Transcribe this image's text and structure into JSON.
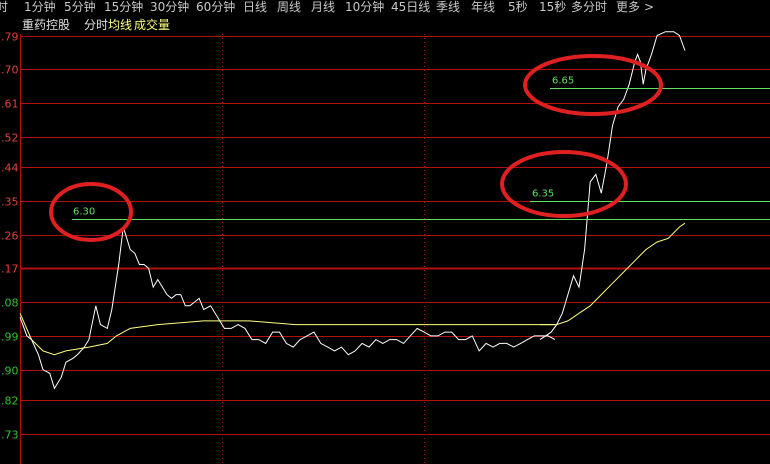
{
  "tabs": [
    {
      "label": "时",
      "id": "fenshi"
    },
    {
      "label": "1分钟",
      "id": "1min"
    },
    {
      "label": "5分钟",
      "id": "5min"
    },
    {
      "label": "15分钟",
      "id": "15min"
    },
    {
      "label": "30分钟",
      "id": "30min"
    },
    {
      "label": "60分钟",
      "id": "60min"
    },
    {
      "label": "日线",
      "id": "day"
    },
    {
      "label": "周线",
      "id": "week"
    },
    {
      "label": "月线",
      "id": "month"
    },
    {
      "label": "10分钟",
      "id": "10min"
    },
    {
      "label": "45日线",
      "id": "45day"
    },
    {
      "label": "季线",
      "id": "quarter"
    },
    {
      "label": "年线",
      "id": "year"
    },
    {
      "label": "5秒",
      "id": "5sec"
    },
    {
      "label": "15秒",
      "id": "15sec"
    },
    {
      "label": "多分时",
      "id": "multi"
    },
    {
      "label": "更多",
      "id": "more"
    }
  ],
  "more_arrow": ">",
  "legend": {
    "stock": "重药控股",
    "price_label": "分时",
    "avg_label": "均线",
    "volume_label": "成交量"
  },
  "colors": {
    "price": "#ffffff",
    "average": "#ffff80",
    "grid_red": "#b01010",
    "axis_red": "#e04040",
    "axis_green": "#30c030",
    "level_line": "#60e060",
    "circle": "#e02020",
    "tab_text": "#c8c8c8"
  },
  "chart_data": {
    "type": "line",
    "title": "",
    "xlabel": "",
    "ylabel": "",
    "ylim": [
      5.69,
      6.81
    ],
    "y_ticks": [
      {
        "value": 6.79,
        "label": ".79",
        "side": "up"
      },
      {
        "value": 6.7,
        "label": ".70",
        "side": "up"
      },
      {
        "value": 6.61,
        "label": ".61",
        "side": "up"
      },
      {
        "value": 6.52,
        "label": ".52",
        "side": "up"
      },
      {
        "value": 6.44,
        "label": ".44",
        "side": "up"
      },
      {
        "value": 6.35,
        "label": ".35",
        "side": "up"
      },
      {
        "value": 6.26,
        "label": ".26",
        "side": "up"
      },
      {
        "value": 6.17,
        "label": ".17",
        "side": "up"
      },
      {
        "value": 6.08,
        "label": ".08",
        "side": "down"
      },
      {
        "value": 5.99,
        "label": ".99",
        "side": "down"
      },
      {
        "value": 5.9,
        "label": ".90",
        "side": "down"
      },
      {
        "value": 5.82,
        "label": ".82",
        "side": "down"
      },
      {
        "value": 5.73,
        "label": ".73",
        "side": "down"
      }
    ],
    "base_value": 6.17,
    "x_points": 234,
    "series": [
      {
        "key": "price",
        "points": [
          [
            0,
            6.04
          ],
          [
            3,
            5.99
          ],
          [
            5,
            5.98
          ],
          [
            8,
            5.94
          ],
          [
            10,
            5.9
          ],
          [
            13,
            5.89
          ],
          [
            15,
            5.85
          ],
          [
            18,
            5.88
          ],
          [
            20,
            5.92
          ],
          [
            23,
            5.93
          ],
          [
            25,
            5.94
          ],
          [
            28,
            5.96
          ],
          [
            30,
            5.98
          ],
          [
            33,
            6.07
          ],
          [
            35,
            6.02
          ],
          [
            38,
            6.01
          ],
          [
            40,
            6.06
          ],
          [
            43,
            6.18
          ],
          [
            45,
            6.28
          ],
          [
            48,
            6.22
          ],
          [
            50,
            6.21
          ],
          [
            52,
            6.18
          ],
          [
            54,
            6.18
          ],
          [
            56,
            6.17
          ],
          [
            58,
            6.12
          ],
          [
            60,
            6.14
          ],
          [
            62,
            6.12
          ],
          [
            64,
            6.1
          ],
          [
            66,
            6.09
          ],
          [
            68,
            6.1
          ],
          [
            70,
            6.1
          ],
          [
            72,
            6.07
          ],
          [
            74,
            6.07
          ],
          [
            76,
            6.08
          ],
          [
            78,
            6.09
          ],
          [
            80,
            6.06
          ],
          [
            83,
            6.07
          ],
          [
            86,
            6.04
          ],
          [
            89,
            6.01
          ],
          [
            92,
            6.01
          ],
          [
            95,
            6.02
          ],
          [
            98,
            6.01
          ],
          [
            101,
            5.98
          ],
          [
            104,
            5.98
          ],
          [
            107,
            5.97
          ],
          [
            110,
            6.0
          ],
          [
            113,
            6.0
          ],
          [
            116,
            5.97
          ],
          [
            119,
            5.96
          ],
          [
            122,
            5.98
          ],
          [
            125,
            5.99
          ],
          [
            128,
            6.0
          ],
          [
            131,
            5.97
          ],
          [
            134,
            5.96
          ],
          [
            137,
            5.95
          ],
          [
            140,
            5.96
          ],
          [
            143,
            5.94
          ],
          [
            146,
            5.95
          ],
          [
            149,
            5.97
          ],
          [
            152,
            5.96
          ],
          [
            155,
            5.98
          ],
          [
            158,
            5.97
          ],
          [
            161,
            5.98
          ],
          [
            164,
            5.98
          ],
          [
            167,
            5.97
          ],
          [
            170,
            5.99
          ],
          [
            173,
            6.01
          ],
          [
            176,
            6.0
          ],
          [
            179,
            5.99
          ],
          [
            182,
            5.99
          ],
          [
            185,
            6.0
          ],
          [
            188,
            6.0
          ],
          [
            191,
            5.98
          ],
          [
            194,
            5.98
          ],
          [
            197,
            5.99
          ],
          [
            200,
            5.95
          ],
          [
            203,
            5.97
          ],
          [
            206,
            5.96
          ],
          [
            209,
            5.97
          ],
          [
            212,
            5.97
          ],
          [
            215,
            5.96
          ],
          [
            218,
            5.97
          ],
          [
            221,
            5.98
          ],
          [
            224,
            5.99
          ],
          [
            227,
            5.99
          ],
          [
            230,
            5.99
          ],
          [
            233,
            5.98
          ]
        ]
      },
      {
        "key": "price_pm",
        "points": [
          [
            0,
            5.98
          ],
          [
            2,
            5.99
          ],
          [
            4,
            6.0
          ],
          [
            6,
            6.02
          ],
          [
            8,
            6.05
          ],
          [
            10,
            6.1
          ],
          [
            12,
            6.15
          ],
          [
            14,
            6.12
          ],
          [
            16,
            6.22
          ],
          [
            18,
            6.4
          ],
          [
            20,
            6.42
          ],
          [
            22,
            6.37
          ],
          [
            24,
            6.45
          ],
          [
            26,
            6.55
          ],
          [
            28,
            6.6
          ],
          [
            30,
            6.62
          ],
          [
            32,
            6.66
          ],
          [
            34,
            6.72
          ],
          [
            35,
            6.74
          ],
          [
            36,
            6.72
          ],
          [
            37,
            6.66
          ],
          [
            38,
            6.7
          ],
          [
            39,
            6.72
          ],
          [
            40,
            6.74
          ],
          [
            42,
            6.79
          ],
          [
            45,
            6.8
          ],
          [
            48,
            6.8
          ],
          [
            50,
            6.79
          ],
          [
            52,
            6.75
          ]
        ]
      },
      {
        "key": "average",
        "points": [
          [
            0,
            6.05
          ],
          [
            5,
            5.98
          ],
          [
            10,
            5.95
          ],
          [
            15,
            5.94
          ],
          [
            20,
            5.95
          ],
          [
            30,
            5.96
          ],
          [
            38,
            5.97
          ],
          [
            42,
            5.99
          ],
          [
            48,
            6.01
          ],
          [
            60,
            6.02
          ],
          [
            80,
            6.03
          ],
          [
            100,
            6.03
          ],
          [
            120,
            6.02
          ],
          [
            140,
            6.02
          ],
          [
            160,
            6.02
          ],
          [
            180,
            6.02
          ],
          [
            200,
            6.02
          ],
          [
            233,
            6.02
          ]
        ]
      },
      {
        "key": "average_pm",
        "points": [
          [
            0,
            6.02
          ],
          [
            6,
            6.02
          ],
          [
            10,
            6.03
          ],
          [
            14,
            6.05
          ],
          [
            18,
            6.07
          ],
          [
            22,
            6.1
          ],
          [
            26,
            6.13
          ],
          [
            30,
            6.16
          ],
          [
            34,
            6.19
          ],
          [
            38,
            6.22
          ],
          [
            42,
            6.24
          ],
          [
            46,
            6.25
          ],
          [
            50,
            6.28
          ],
          [
            52,
            6.29
          ]
        ]
      }
    ],
    "annotations": [
      {
        "label": "6.30",
        "value": 6.3
      },
      {
        "label": "6.35",
        "value": 6.35
      },
      {
        "label": "6.65",
        "value": 6.65
      }
    ]
  }
}
